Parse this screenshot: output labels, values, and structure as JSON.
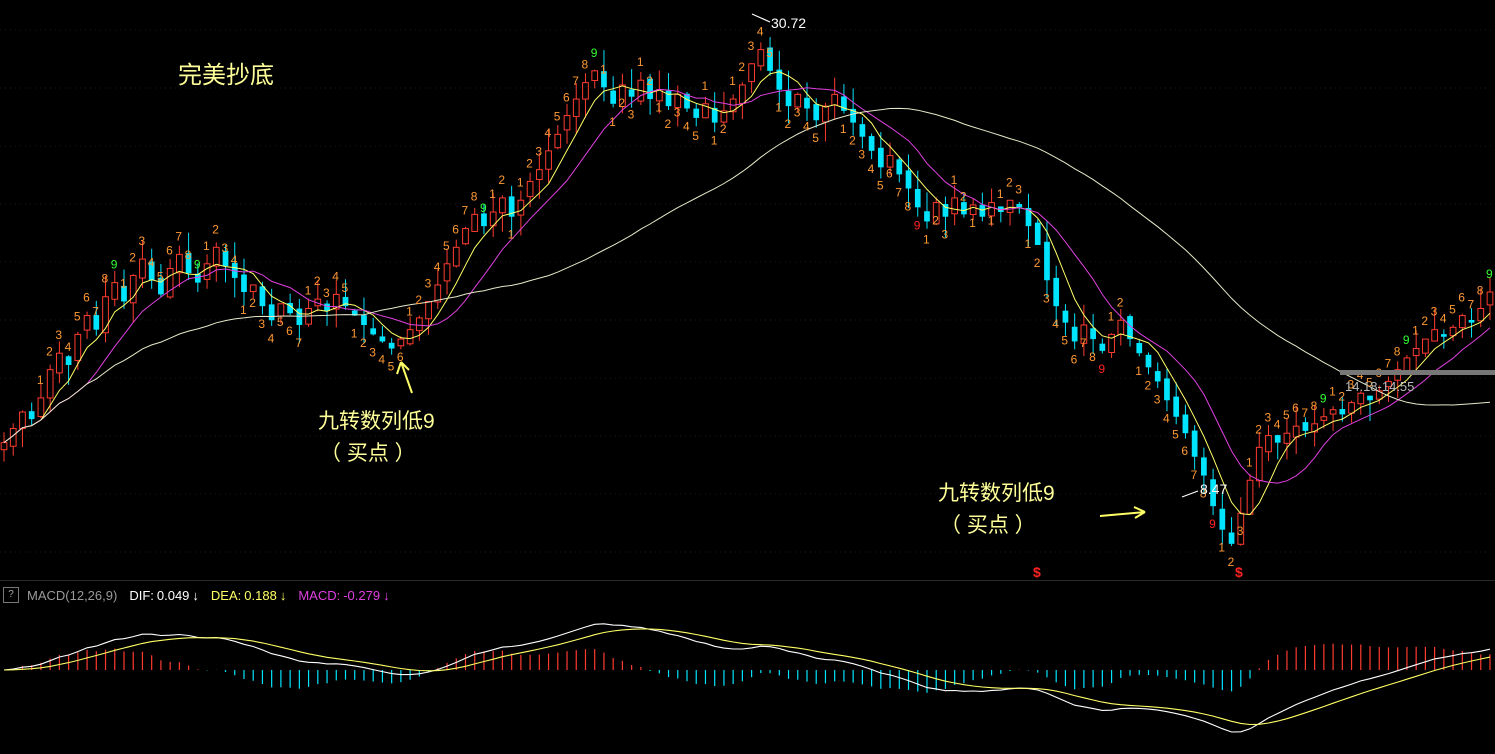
{
  "title": "完美抄底",
  "annotations": [
    {
      "line1": "九转数列低9",
      "line2": "（ 买点 ）"
    },
    {
      "line1": "九转数列低9",
      "line2": "（ 买点 ）"
    }
  ],
  "price_labels": {
    "high": "30.72",
    "low": "8.47",
    "range": "14.18-14.55"
  },
  "macd_header": {
    "help": "?",
    "name": "MACD(12,26,9)",
    "dif_label": "DIF:",
    "dif_value": "0.049",
    "dea_label": "DEA:",
    "dea_value": "0.188",
    "macd_label": "MACD:",
    "macd_value": "-0.279",
    "arrow": "↓"
  },
  "signal_glyph": "$",
  "colors": {
    "bg": "#000000",
    "up": "#ff3b30",
    "down": "#00e5ff",
    "ma5": "#ffff66",
    "ma10": "#e040e0",
    "ma60": "#e8e8c8",
    "dif": "#ffffff",
    "dea": "#ffff66",
    "td_num": "#ff9933",
    "td_nine_high": "#33ff33",
    "td_nine_low": "#ff2222",
    "annotation": "#ffff99"
  },
  "chart_data": {
    "type": "candlestick",
    "price_range": [
      8.0,
      31.5
    ],
    "closes": [
      13.2,
      13.8,
      14.5,
      14.2,
      15.1,
      16.3,
      17.0,
      16.5,
      17.8,
      18.6,
      18.0,
      19.4,
      20.0,
      19.2,
      20.3,
      21.0,
      20.1,
      19.5,
      20.6,
      21.2,
      20.4,
      20.0,
      20.8,
      21.5,
      20.7,
      20.2,
      19.6,
      19.9,
      19.0,
      18.4,
      19.1,
      18.7,
      18.2,
      18.9,
      19.3,
      18.8,
      19.5,
      19.0,
      18.6,
      18.2,
      17.8,
      17.5,
      17.2,
      17.6,
      18.0,
      18.5,
      19.2,
      19.9,
      20.8,
      21.5,
      22.3,
      22.9,
      22.4,
      23.0,
      23.6,
      22.8,
      23.5,
      24.3,
      24.8,
      25.6,
      26.3,
      27.1,
      27.8,
      28.5,
      29.0,
      28.3,
      27.6,
      28.4,
      27.9,
      28.6,
      27.8,
      28.2,
      27.5,
      28.0,
      27.4,
      27.0,
      27.6,
      26.8,
      27.3,
      27.8,
      28.4,
      29.3,
      29.9,
      29.0,
      28.2,
      27.5,
      28.0,
      27.4,
      26.9,
      27.5,
      28.0,
      27.3,
      26.8,
      26.2,
      25.6,
      24.9,
      25.4,
      24.6,
      24.0,
      23.2,
      22.6,
      23.4,
      22.8,
      23.6,
      22.9,
      23.3,
      22.8,
      23.4,
      23.0,
      23.5,
      23.2,
      22.4,
      21.6,
      20.1,
      19.0,
      18.3,
      17.5,
      18.2,
      17.6,
      17.1,
      17.8,
      18.4,
      17.6,
      17.0,
      16.4,
      15.8,
      15.0,
      14.3,
      13.6,
      12.6,
      11.8,
      10.5,
      9.5,
      8.9,
      10.2,
      11.6,
      13.0,
      13.5,
      13.2,
      13.6,
      13.9,
      13.7,
      14.0,
      14.3,
      14.6,
      14.4,
      14.9,
      15.3,
      15.0,
      15.4,
      15.8,
      16.3,
      16.8,
      17.2,
      17.6,
      18.0,
      17.7,
      18.1,
      18.6,
      18.3,
      18.9,
      19.6
    ]
  }
}
